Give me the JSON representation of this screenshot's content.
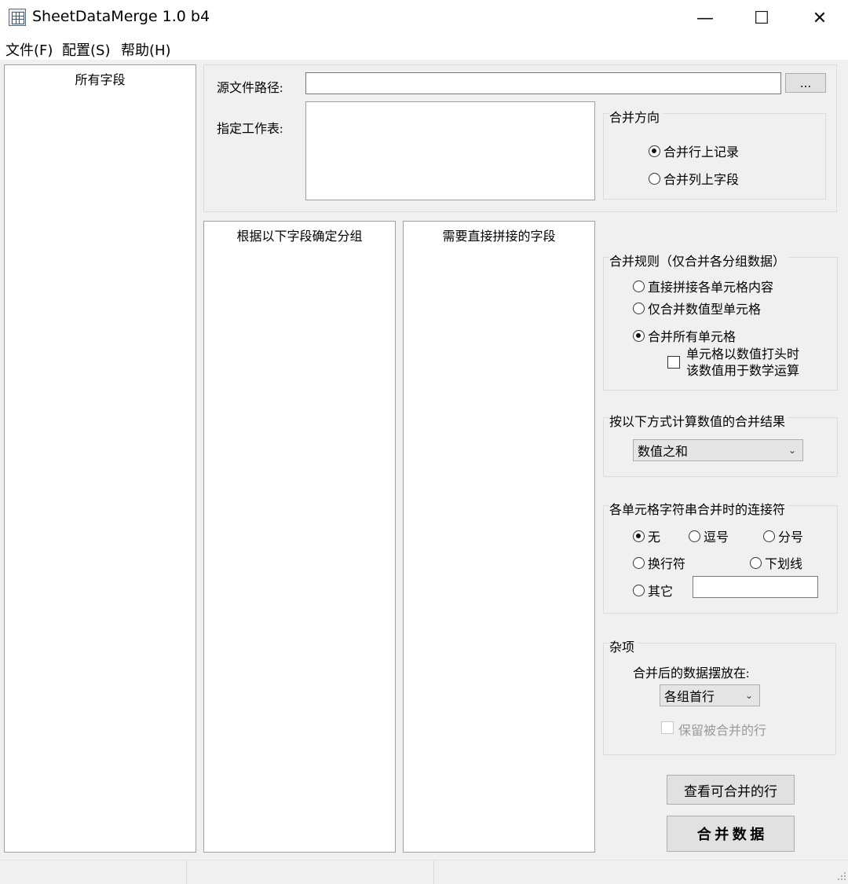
{
  "window": {
    "title": "SheetDataMerge 1.0 b4",
    "minimize_glyph": "—",
    "maximize_glyph": "☐",
    "close_glyph": "✕"
  },
  "menu": {
    "items": [
      "文件(F)",
      "配置(S)",
      "帮助(H)"
    ]
  },
  "all_fields": {
    "header": "所有字段"
  },
  "source": {
    "path_label": "源文件路径:",
    "path_value": "",
    "browse_label": "...",
    "sheet_label": "指定工作表:"
  },
  "merge_direction": {
    "title": "合并方向",
    "options": [
      "合并行上记录",
      "合并列上字段"
    ],
    "selected": 0
  },
  "group_fields": {
    "header": "根据以下字段确定分组"
  },
  "concat_fields": {
    "header": "需要直接拼接的字段"
  },
  "merge_rules": {
    "title": "合并规则（仅合并各分组数据）",
    "options": [
      "直接拼接各单元格内容",
      "仅合并数值型单元格",
      "合并所有单元格"
    ],
    "selected": 2,
    "checkbox_line1": "单元格以数值打头时",
    "checkbox_line2": "该数值用于数学运算"
  },
  "calc": {
    "title": "按以下方式计算数值的合并结果",
    "selected_value": "数值之和"
  },
  "separator": {
    "title": "各单元格字符串合并时的连接符",
    "options": [
      "无",
      "逗号",
      "分号",
      "换行符",
      "下划线",
      "其它"
    ],
    "selected": 0,
    "other_value": ""
  },
  "misc": {
    "title": "杂项",
    "placement_label": "合并后的数据摆放在:",
    "placement_value": "各组首行",
    "keep_rows_label": "保留被合并的行"
  },
  "actions": {
    "view_label": "查看可合并的行",
    "merge_label": "合 并 数 据"
  },
  "icons": {
    "chevron": "⌄"
  }
}
